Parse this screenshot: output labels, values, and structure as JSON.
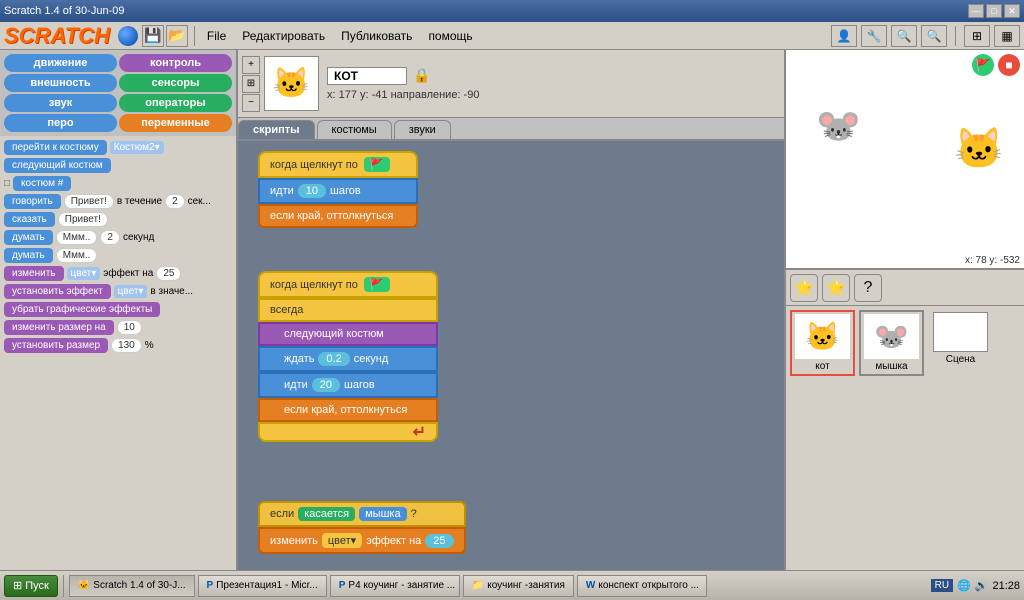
{
  "titlebar": {
    "title": "Scratch 1.4 of 30-Jun-09",
    "min": "—",
    "max": "□",
    "close": "✕"
  },
  "menubar": {
    "file": "File",
    "edit": "Редактировать",
    "publish": "Публиковать",
    "help": "помощь"
  },
  "categories": [
    {
      "label": "движение",
      "class": "cat-blue"
    },
    {
      "label": "контроль",
      "class": "cat-purple"
    },
    {
      "label": "внешность",
      "class": "cat-blue"
    },
    {
      "label": "сенсоры",
      "class": "cat-green"
    },
    {
      "label": "звук",
      "class": "cat-blue"
    },
    {
      "label": "операторы",
      "class": "cat-green"
    },
    {
      "label": "перо",
      "class": "cat-blue"
    },
    {
      "label": "переменные",
      "class": "cat-orange"
    }
  ],
  "blocks": [
    {
      "text": "перейти к костюму",
      "extra": "Костюм2▾"
    },
    {
      "text": "следующий костюм"
    },
    {
      "text": "□ костюм #"
    },
    {
      "text": "говорить",
      "val1": "Привет!",
      "val2": "в течение",
      "val3": "2",
      "val4": "сек..."
    },
    {
      "text": "сказать",
      "val1": "Привет!"
    },
    {
      "text": "думать",
      "val1": "Ммм..",
      "val2": "2",
      "val3": "секунд"
    },
    {
      "text": "думать",
      "val1": "Ммм.."
    },
    {
      "text": "изменить",
      "val1": "цвет▾",
      "val2": "эффект на",
      "val3": "25"
    },
    {
      "text": "установить эффект",
      "val1": "цвет▾",
      "val2": "в значе..."
    },
    {
      "text": "убрать графические эффекты"
    },
    {
      "text": "изменить размер на",
      "val1": "10"
    },
    {
      "text": "установить размер",
      "val1": "130",
      "val2": "%"
    }
  ],
  "sprite": {
    "name": "КОТ",
    "x": "177",
    "y": "-41",
    "direction": "-90",
    "coords_label": "x: 177  y: -41  направление: -90"
  },
  "tabs": [
    "скрипты",
    "костюмы",
    "звуки"
  ],
  "active_tab": "скрипты",
  "scripts": {
    "group1": {
      "blocks": [
        {
          "type": "hat",
          "text": "когда щелкнут по 🚩"
        },
        {
          "type": "blue",
          "text": "идти",
          "val": "10",
          "suffix": "шагов"
        },
        {
          "type": "orange",
          "text": "если край, оттолкнуться"
        }
      ]
    },
    "group2": {
      "blocks": [
        {
          "type": "hat",
          "text": "когда щелкнут по 🚩"
        },
        {
          "type": "loop",
          "text": "всегда"
        },
        {
          "type": "purple",
          "text": "следующий костюм"
        },
        {
          "type": "blue2",
          "text": "ждать",
          "val": "0.2",
          "suffix": "секунд"
        },
        {
          "type": "blue",
          "text": "идти",
          "val": "20",
          "suffix": "шагов"
        },
        {
          "type": "orange",
          "text": "если край, оттолкнуться"
        },
        {
          "type": "arrow",
          "text": "↵"
        }
      ]
    },
    "group3": {
      "blocks": [
        {
          "type": "if",
          "text": "если",
          "cond": "касается мышка ?"
        },
        {
          "type": "orange2",
          "text": "изменить",
          "val1": "цвет▾",
          "mid": "эффект на",
          "val2": "25"
        }
      ]
    }
  },
  "stage": {
    "coords": "x: 78   y: -532"
  },
  "sprites": [
    {
      "label": "кот",
      "icon": "🐱",
      "selected": true
    },
    {
      "label": "мышка",
      "icon": "🐭",
      "selected": false
    }
  ],
  "scene_label": "Сцена",
  "toolbar_icons": [
    "⭐",
    "⭐",
    "?"
  ],
  "taskbar": {
    "start": "Пуск",
    "apps": [
      {
        "label": "Scratch 1.4 of 30-J...",
        "active": true,
        "icon": "🐱"
      },
      {
        "label": "Презентация1 - Micr...",
        "active": false,
        "icon": "P"
      },
      {
        "label": "P4 коучинг - занятие ...",
        "active": false,
        "icon": "P"
      },
      {
        "label": "коучинг -занятия",
        "active": false,
        "icon": "📁"
      },
      {
        "label": "конспект открытого ...",
        "active": false,
        "icon": "W"
      }
    ],
    "lang": "RU",
    "time": "21:28"
  }
}
